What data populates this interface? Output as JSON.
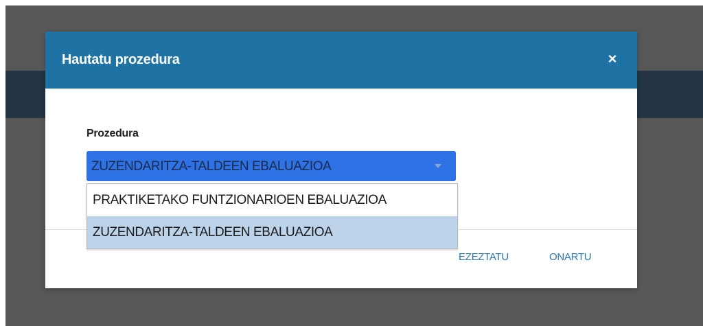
{
  "modal": {
    "title": "Hautatu prozedura",
    "close_symbol": "×",
    "field_label": "Prozedura",
    "select_value": "ZUZENDARITZA-TALDEEN EBALUAZIOA",
    "cancel_label": "EZEZTATU",
    "accept_label": "ONARTU"
  },
  "dropdown": {
    "options": [
      {
        "label": "PRAKTIKETAKO FUNTZIONARIOEN EBALUAZIOA",
        "selected": false
      },
      {
        "label": "ZUZENDARITZA-TALDEEN EBALUAZIOA",
        "selected": true
      }
    ]
  },
  "colors": {
    "overlay": "#575757",
    "header_band": "#243444",
    "modal_header": "#1f72a4",
    "select_focus": "#2f72e6",
    "button_text": "#2a78b8",
    "option_highlight": "#bcd3ea"
  },
  "icons": {
    "close": "close-icon",
    "select_arrow": "chevron-down-icon"
  }
}
